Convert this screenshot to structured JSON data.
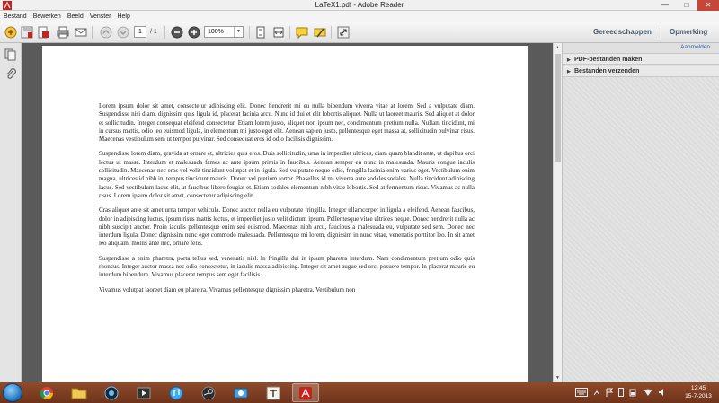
{
  "window": {
    "title": "LaTeX1.pdf - Adobe Reader",
    "min": "—",
    "max": "□",
    "close": "✕"
  },
  "menu": [
    "Bestand",
    "Bewerken",
    "Beeld",
    "Venster",
    "Help"
  ],
  "toolbar": {
    "page_current": "1",
    "page_total": "/ 1",
    "zoom": "100%",
    "zoom_arrow": "▼",
    "tabs": {
      "tools": "Gereedschappen",
      "comment": "Opmerking"
    },
    "icons": [
      "create-icon",
      "save-icon",
      "print-icon",
      "email-icon",
      "page-up-icon",
      "page-down-icon",
      "zoom-out-icon",
      "zoom-in-icon",
      "fit-page-icon",
      "fit-width-icon",
      "comment-icon",
      "highlight-icon",
      "expand-icon"
    ]
  },
  "right_panel": {
    "sign_in": "Aanmelden",
    "items": [
      {
        "label": "PDF-bestanden maken",
        "arrow": "▶"
      },
      {
        "label": "Bestanden verzenden",
        "arrow": "▶"
      }
    ]
  },
  "scrollbar": {
    "up": "▲",
    "down": "▼"
  },
  "document": {
    "paragraphs": [
      "Lorem ipsum dolor sit amet, consectetur adipiscing elit. Donec hendrerit mi eu nulla bibendum viverra vitae at lorem. Sed a vulputate diam. Suspendisse nisi diam, dignissim quis ligula id, placerat lacinia arcu. Nunc id dui et elit lobortis aliquet. Nulla ut laoreet mauris. Sed aliquet at dolor et sollicitudin. Integer consequat eleifend consectetur. Etiam lorem justo, aliquet non ipsum nec, condimentum pretium nulla. Nullam tincidunt, mi in cursus mattis, odio leo euismod ligula, in elementum mi justo eget elit. Aenean sapien justo, pellentesque eget massa at, sollicitudin pulvinar risus. Maecenas vestibulum sem ut tempor pulvinar. Sed consequat eros id odio facilisis dignissim.",
      "Suspendisse lorem diam, gravida at ornare et, ultricies quis eros. Duis sollicitudin, urna in imperdiet ultrices, diam quam blandit ante, ut dapibus orci lectus ut massa. Interdum et malesuada fames ac ante ipsum primis in faucibus. Aenean semper eu nunc in malesuada. Mauris congue iaculis sollicitudin. Maecenas nec eros vel velit tincidunt volutpat et in ligula. Sed vulputate neque odio, fringilla lacinia enim varius eget. Vestibulum enim magna, ultrices id nibh in, tempus tincidunt mauris. Donec vel pretium tortor. Phasellus id mi viverra ante sodales sodales. Nulla tincidunt adipiscing lacus. Sed vestibulum lacus elit, ut faucibus libero feugiat et. Etiam sodales elementum nibh vitae lobortis. Sed at fermentum risus. Vivamus ac nulla risus. Lorem ipsum dolor sit amet, consectetur adipiscing elit.",
      "Cras aliquet ante sit amet urna tempor vehicula. Donec auctor nulla eu vulputate fringilla. Integer ullamcorper in ligula a eleifend. Aenean faucibus, dolor in adipiscing luctus, ipsum risus mattis lectus, et imperdiet justo velit dictum ipsum. Pellentesque vitae ultrices neque. Donec hendrerit nulla ac nibh suscipit auctor. Proin iaculis pellentesque enim sed euismod. Maecenas nibh arcu, faucibus a malesuada eu, vulputate sed sem. Donec nec interdum ligula. Donec dignissim nunc eget commodo malesuada. Pellentesque mi lorem, dignissim in nunc vitae, venenatis porttitor leo. In sit amet leo aliquam, mollis ante nec, ornare felis.",
      "Suspendisse a enim pharetra, porta tellus sed, venenatis nisl. In fringilla dui in ipsum pharetra interdum. Nam condimentum pretium odio quis rhoncus. Integer auctor massa nec odio consectetur, in iaculis massa adipiscing. Integer sit amet augue sed orci posuere tempor. In placerat mauris eu interdum bibendum. Vivamus placerat tempus sem eget facilisis.",
      "Vivamus volutpat laoreet diam eu pharetra. Vivamus pellentesque dignissim pharetra. Vestibulum non"
    ]
  },
  "taskbar": {
    "apps": [
      "chrome-icon",
      "file-explorer-icon",
      "steam-like-icon",
      "media-player-icon",
      "itunes-icon",
      "steam-icon",
      "network-icon",
      "texworks-icon",
      "adobe-reader-icon"
    ],
    "clock_time": "12:45",
    "clock_date": "15-7-2013"
  },
  "colors": {
    "taskbar": "#7a3b1f",
    "accent": "#c7463a",
    "link": "#2b5fa8"
  }
}
